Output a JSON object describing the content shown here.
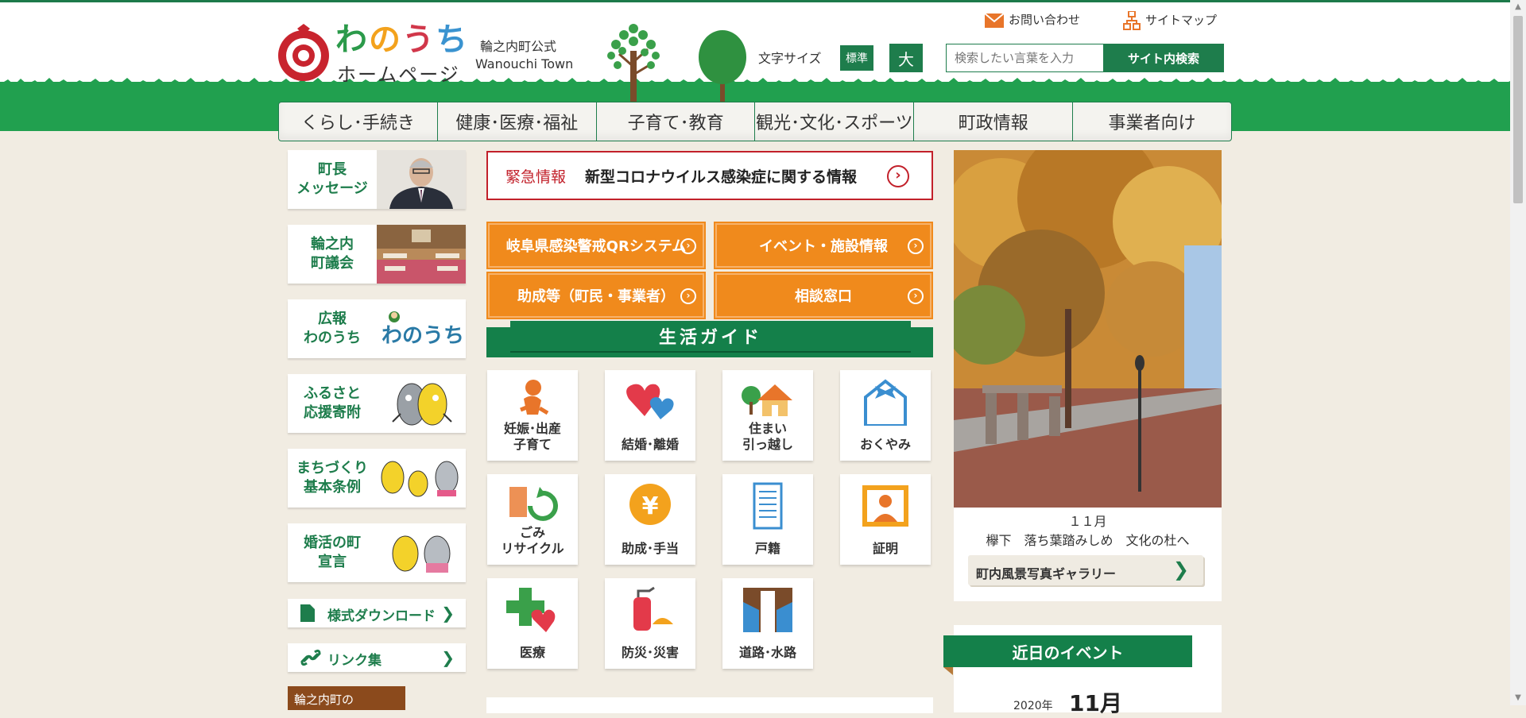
{
  "header": {
    "logo_main": [
      "わ",
      "の",
      "う",
      "ち"
    ],
    "logo_sub": "ホームページ",
    "town_jp": "輪之内町公式",
    "town_en": "Wanouchi Town",
    "font_size_label": "文字サイズ",
    "font_std": "標準",
    "font_large": "大",
    "contact": "お問い合わせ",
    "sitemap": "サイトマップ",
    "search_placeholder": "検索したい言葉を入力",
    "search_button": "サイト内検索"
  },
  "nav": [
    "くらし･手続き",
    "健康･医療･福祉",
    "子育て･教育",
    "観光･文化･スポーツ",
    "町政情報",
    "事業者向け"
  ],
  "sidebar": {
    "cards": [
      {
        "label": "町長\nメッセージ",
        "art": "photo-mayor"
      },
      {
        "label": "輪之内\n町議会",
        "art": "photo-assembly"
      },
      {
        "label": "広報\nわのうち",
        "art": "kouhou-logo",
        "art_text": "わのうち"
      },
      {
        "label": "ふるさと\n応援寄附",
        "art": "fish-mascots"
      },
      {
        "label": "まちづくり\n基本条例",
        "art": "mascots"
      },
      {
        "label": "婚活の町\n宣言",
        "art": "couple-mascots"
      }
    ],
    "forms": "様式ダウンロード",
    "links": "リンク集",
    "bottom": "輪之内町の"
  },
  "alert": {
    "tag": "緊急情報",
    "message": "新型コロナウイルス感染症に関する情報"
  },
  "orange_buttons": [
    "岐阜県感染警戒QRシステム",
    "イベント・施設情報",
    "助成等（町民・事業者）",
    "相談窓口"
  ],
  "guide": {
    "title": "生活ガイド",
    "items": [
      {
        "label": "妊娠･出産\n子育て",
        "icon": "baby-icon"
      },
      {
        "label": "結婚･離婚",
        "icon": "heart-icon"
      },
      {
        "label": "住まい\n引っ越し",
        "icon": "house-icon"
      },
      {
        "label": "おくやみ",
        "icon": "ribbon-house-icon"
      },
      {
        "label": "ごみ\nリサイクル",
        "icon": "recycle-icon"
      },
      {
        "label": "助成･手当",
        "icon": "yen-icon"
      },
      {
        "label": "戸籍",
        "icon": "document-icon"
      },
      {
        "label": "証明",
        "icon": "portrait-icon"
      },
      {
        "label": "医療",
        "icon": "medical-icon"
      },
      {
        "label": "防災･災害",
        "icon": "extinguisher-icon"
      },
      {
        "label": "道路･水路",
        "icon": "road-icon"
      }
    ]
  },
  "photo": {
    "month": "１１月",
    "caption": "欅下　落ち葉踏みしめ　文化の杜へ",
    "gallery": "町内風景写真ギャラリー"
  },
  "events": {
    "title": "近日のイベント",
    "year": "2020年",
    "month": "11月"
  },
  "colors": {
    "brand_green": "#1e7d4c",
    "alert_red": "#c2202a",
    "orange": "#f08a1c"
  }
}
